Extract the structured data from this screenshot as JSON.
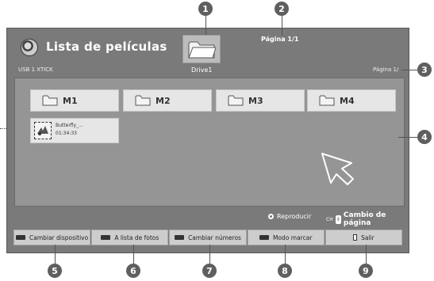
{
  "header": {
    "title": "Lista de películas",
    "device": "USB 1 XTICK",
    "drive_label": "Drive1",
    "page_top": "Página 1/1",
    "page_right": "Página 1/"
  },
  "folders": [
    {
      "name": "M1"
    },
    {
      "name": "M2"
    },
    {
      "name": "M3"
    },
    {
      "name": "M4"
    }
  ],
  "movie": {
    "name": "Butterfly_...",
    "duration": "01:34:33"
  },
  "hints": {
    "play": "Reproducir",
    "ch_key": "CH",
    "page_change": "Cambio de página"
  },
  "buttons": [
    {
      "label": "Cambiar dispositivo"
    },
    {
      "label": "A lista de fotos"
    },
    {
      "label": "Cambiar números"
    },
    {
      "label": "Modo marcar"
    },
    {
      "label": "Salir"
    }
  ],
  "callouts": [
    "1",
    "2",
    "3",
    "4",
    "5",
    "6",
    "7",
    "8",
    "9"
  ],
  "icons": {
    "title": "film-reel-icon",
    "drive": "folder-icon",
    "cursor": "pointer-arrow-icon",
    "play": "ok-button-icon",
    "exit": "exit-icon"
  },
  "colors": {
    "screen_bg": "#7a7a7a",
    "panel_bg": "#959595",
    "tile_bg": "#e6e6e6",
    "button_bg": "#cdcdcd",
    "callout_bg": "#5f5f5f"
  }
}
